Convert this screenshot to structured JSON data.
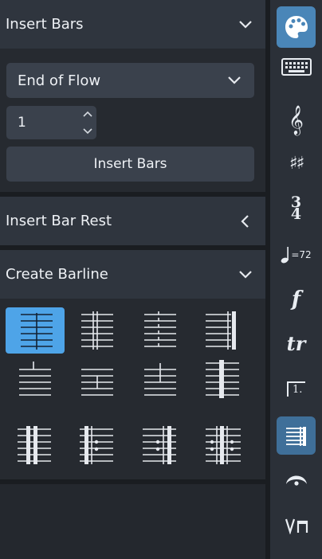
{
  "insert_bars": {
    "title": "Insert Bars",
    "position_select": "End of Flow",
    "count": "1",
    "insert_button": "Insert Bars"
  },
  "insert_bar_rest": {
    "title": "Insert Bar Rest"
  },
  "create_barline": {
    "title": "Create Barline",
    "barlines": [
      {
        "name": "single-barline",
        "selected": true
      },
      {
        "name": "double-barline",
        "selected": false
      },
      {
        "name": "dashed-barline",
        "selected": false
      },
      {
        "name": "final-barline",
        "selected": false
      },
      {
        "name": "tick-barline",
        "selected": false
      },
      {
        "name": "short-barline",
        "selected": false
      },
      {
        "name": "short-double-barline",
        "selected": false
      },
      {
        "name": "heavy-barline",
        "selected": false
      },
      {
        "name": "heavy-double-barline",
        "selected": false
      },
      {
        "name": "start-repeat-barline",
        "selected": false
      },
      {
        "name": "end-repeat-barline",
        "selected": false
      },
      {
        "name": "end-start-repeat-barline",
        "selected": false
      }
    ]
  },
  "toolbar": {
    "items": [
      {
        "icon": "palette-icon",
        "label": ""
      },
      {
        "icon": "keyboard-icon",
        "label": ""
      },
      {
        "icon": "treble-clef-icon",
        "label": "𝄞"
      },
      {
        "icon": "key-signature-icon",
        "label": "♯♯"
      },
      {
        "icon": "time-signature-icon",
        "label": ""
      },
      {
        "icon": "tempo-icon",
        "label": "=72"
      },
      {
        "icon": "dynamics-icon",
        "label": "f"
      },
      {
        "icon": "ornaments-icon",
        "label": "tr"
      },
      {
        "icon": "repeat-ending-icon",
        "label": "1."
      },
      {
        "icon": "barlines-icon",
        "label": ""
      },
      {
        "icon": "fermata-icon",
        "label": ""
      },
      {
        "icon": "bowing-icon",
        "label": ""
      }
    ],
    "time_signature": {
      "top": "3",
      "bottom": "4"
    }
  },
  "colors": {
    "selected_barline": "#4ea4e8",
    "toolbar_active": "#3f6f99",
    "header_bg": "#2f353e"
  }
}
